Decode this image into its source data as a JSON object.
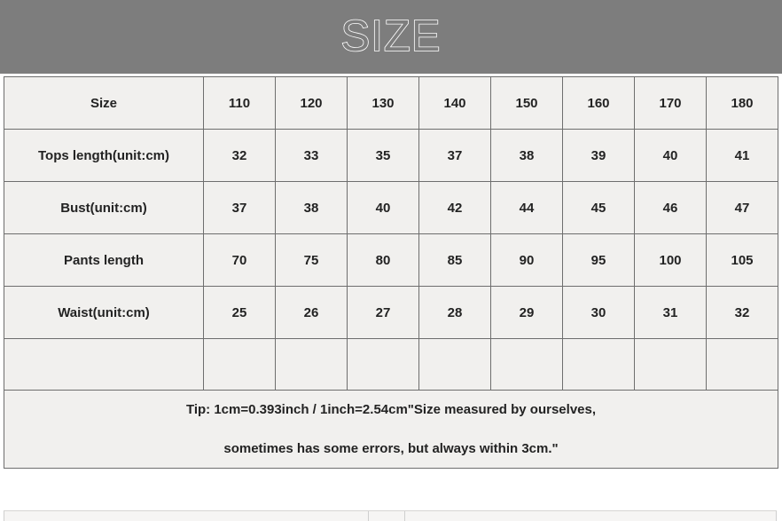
{
  "banner": {
    "title": "SIZE"
  },
  "colors": {
    "banner_background": "#7d7d7d",
    "banner_title_outline": "#ffffff",
    "cell_background": "#f1f0ee",
    "cell_border": "#6e6e6e",
    "text": "#232323"
  },
  "table": {
    "header": {
      "label": "Size",
      "sizes": [
        "110",
        "120",
        "130",
        "140",
        "150",
        "160",
        "170",
        "180"
      ]
    },
    "rows": [
      {
        "label": "Tops length(unit:cm)",
        "values": [
          "32",
          "33",
          "35",
          "37",
          "38",
          "39",
          "40",
          "41"
        ]
      },
      {
        "label": "Bust(unit:cm)",
        "values": [
          "37",
          "38",
          "40",
          "42",
          "44",
          "45",
          "46",
          "47"
        ]
      },
      {
        "label": "Pants length",
        "values": [
          "70",
          "75",
          "80",
          "85",
          "90",
          "95",
          "100",
          "105"
        ]
      },
      {
        "label": "Waist(unit:cm)",
        "values": [
          "25",
          "26",
          "27",
          "28",
          "29",
          "30",
          "31",
          "32"
        ]
      }
    ],
    "empty_row": {
      "label": "",
      "values": [
        "",
        "",
        "",
        "",
        "",
        "",
        "",
        ""
      ]
    },
    "tip": {
      "line1": "Tip: 1cm=0.393inch / 1inch=2.54cm\"Size measured by ourselves,",
      "line2": "sometimes has some errors, but always within 3cm.\""
    }
  }
}
